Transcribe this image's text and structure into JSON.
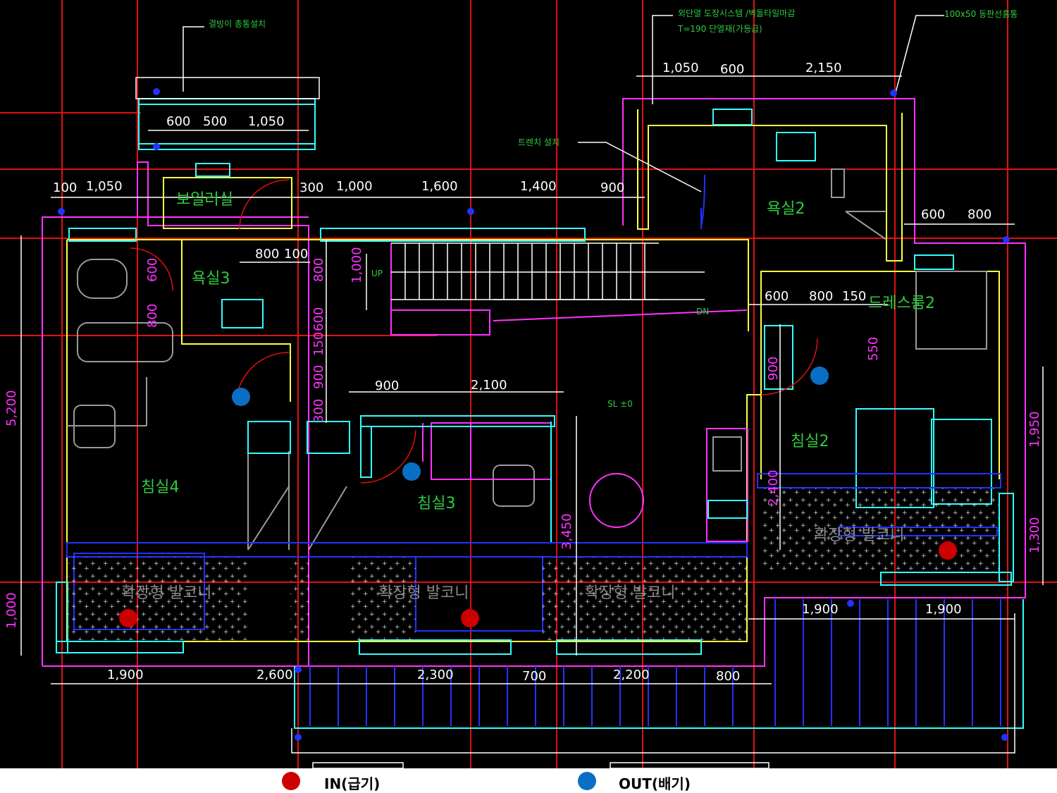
{
  "rooms": {
    "boiler": "보일러실",
    "bath3": "욕실3",
    "bath2": "욕실2",
    "dress2": "드레스룸2",
    "bed4": "침실4",
    "bed3": "침실3",
    "bed2": "침실2",
    "balcony": "확장형 발코니"
  },
  "notes": {
    "note1": "결빙이 총통설치",
    "note2": "외단열 도장시스템 /벽돌타일마감",
    "note3": "T=190 단열재(가등급)",
    "note4": "100x50 동판선홈통",
    "trench": "트렌치 설치",
    "sl": "SL ±0",
    "up": "UP",
    "dn": "DN"
  },
  "dims": {
    "top_left": [
      "600",
      "500",
      "1,050"
    ],
    "top_right": [
      "1,050",
      "600",
      "2,150"
    ],
    "row_mid": [
      "100",
      "1,050",
      "300",
      "1,000",
      "1,600",
      "1,400",
      "900"
    ],
    "right_upper": [
      "600",
      "800"
    ],
    "dress": [
      "600",
      "800",
      "150"
    ],
    "bath3_a": [
      "800",
      "100"
    ],
    "bottom": [
      "1,900",
      "2,600",
      "2,300",
      "700",
      "2,200",
      "800"
    ],
    "bottom_right": [
      "1,900",
      "1,900"
    ],
    "mid": [
      "900",
      "2,100"
    ],
    "vert_left": [
      "5,200",
      "1,000"
    ],
    "vert_right": [
      "1,950",
      "1,300"
    ],
    "vert_mid": [
      "1,000",
      "800",
      "150",
      "600",
      "900",
      "300",
      "900",
      "550",
      "2,400",
      "3,450",
      "600",
      "800"
    ]
  },
  "legend": {
    "in_label": "IN(급기)",
    "out_label": "OUT(배기)",
    "in_color": "#cc0000",
    "out_color": "#0a6fc4"
  },
  "colors": {
    "background": "#000000",
    "wall_yellow": "#ffff44",
    "outline_magenta": "#ff33ff",
    "grid_red": "#e01010",
    "window_cyan": "#33ffff",
    "text_green": "#2ecc40"
  }
}
